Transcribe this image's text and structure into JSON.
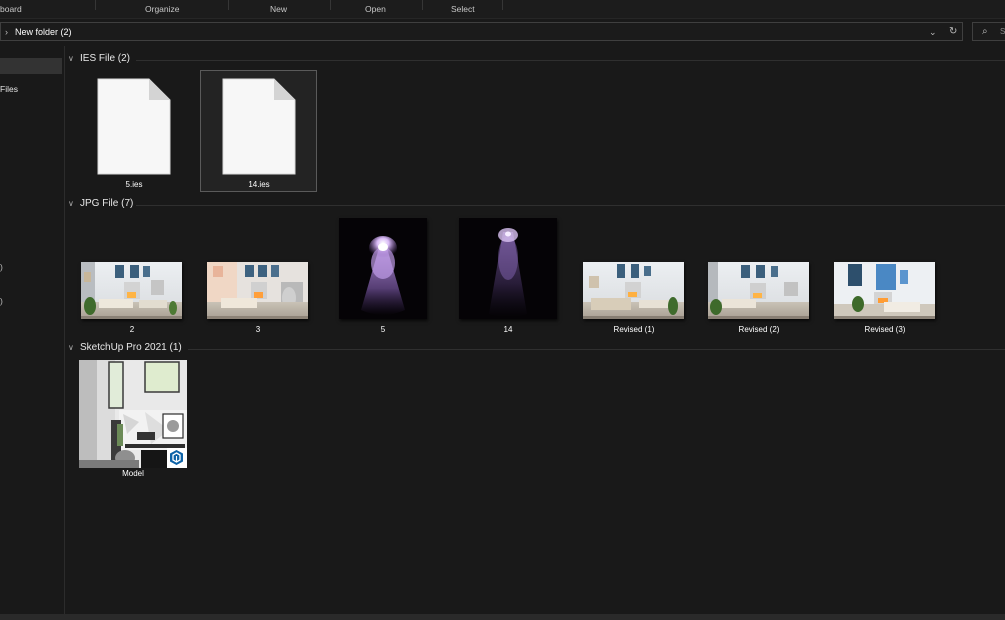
{
  "ribbon": {
    "clipboard": "board",
    "organize": "Organize",
    "new": "New",
    "open": "Open",
    "select": "Select"
  },
  "address": {
    "path": "New folder (2)",
    "search_placeholder": "S"
  },
  "nav": {
    "files_label": "Files",
    "partial_1": ")",
    "partial_2": ")"
  },
  "groups": [
    {
      "title": "IES File (2)",
      "items": [
        {
          "label": "5.ies"
        },
        {
          "label": "14.ies"
        }
      ]
    },
    {
      "title": "JPG File (7)",
      "items": [
        {
          "label": "2"
        },
        {
          "label": "3"
        },
        {
          "label": "5"
        },
        {
          "label": "14"
        },
        {
          "label": "Revised (1)"
        },
        {
          "label": "Revised (2)"
        },
        {
          "label": "Revised (3)"
        }
      ]
    },
    {
      "title": "SketchUp Pro 2021 (1)",
      "items": [
        {
          "label": "Model"
        }
      ]
    }
  ],
  "colors": {
    "background": "#191919",
    "selection": "#5a5a5a",
    "light_glow": "#c9a6ee",
    "sketchup_badge": "#0d62a7"
  },
  "icons": {
    "group_toggle": "chevron-down-icon",
    "address": "chevron-right-icon",
    "refresh": "refresh-icon",
    "search": "search-icon",
    "file": "document-icon"
  }
}
